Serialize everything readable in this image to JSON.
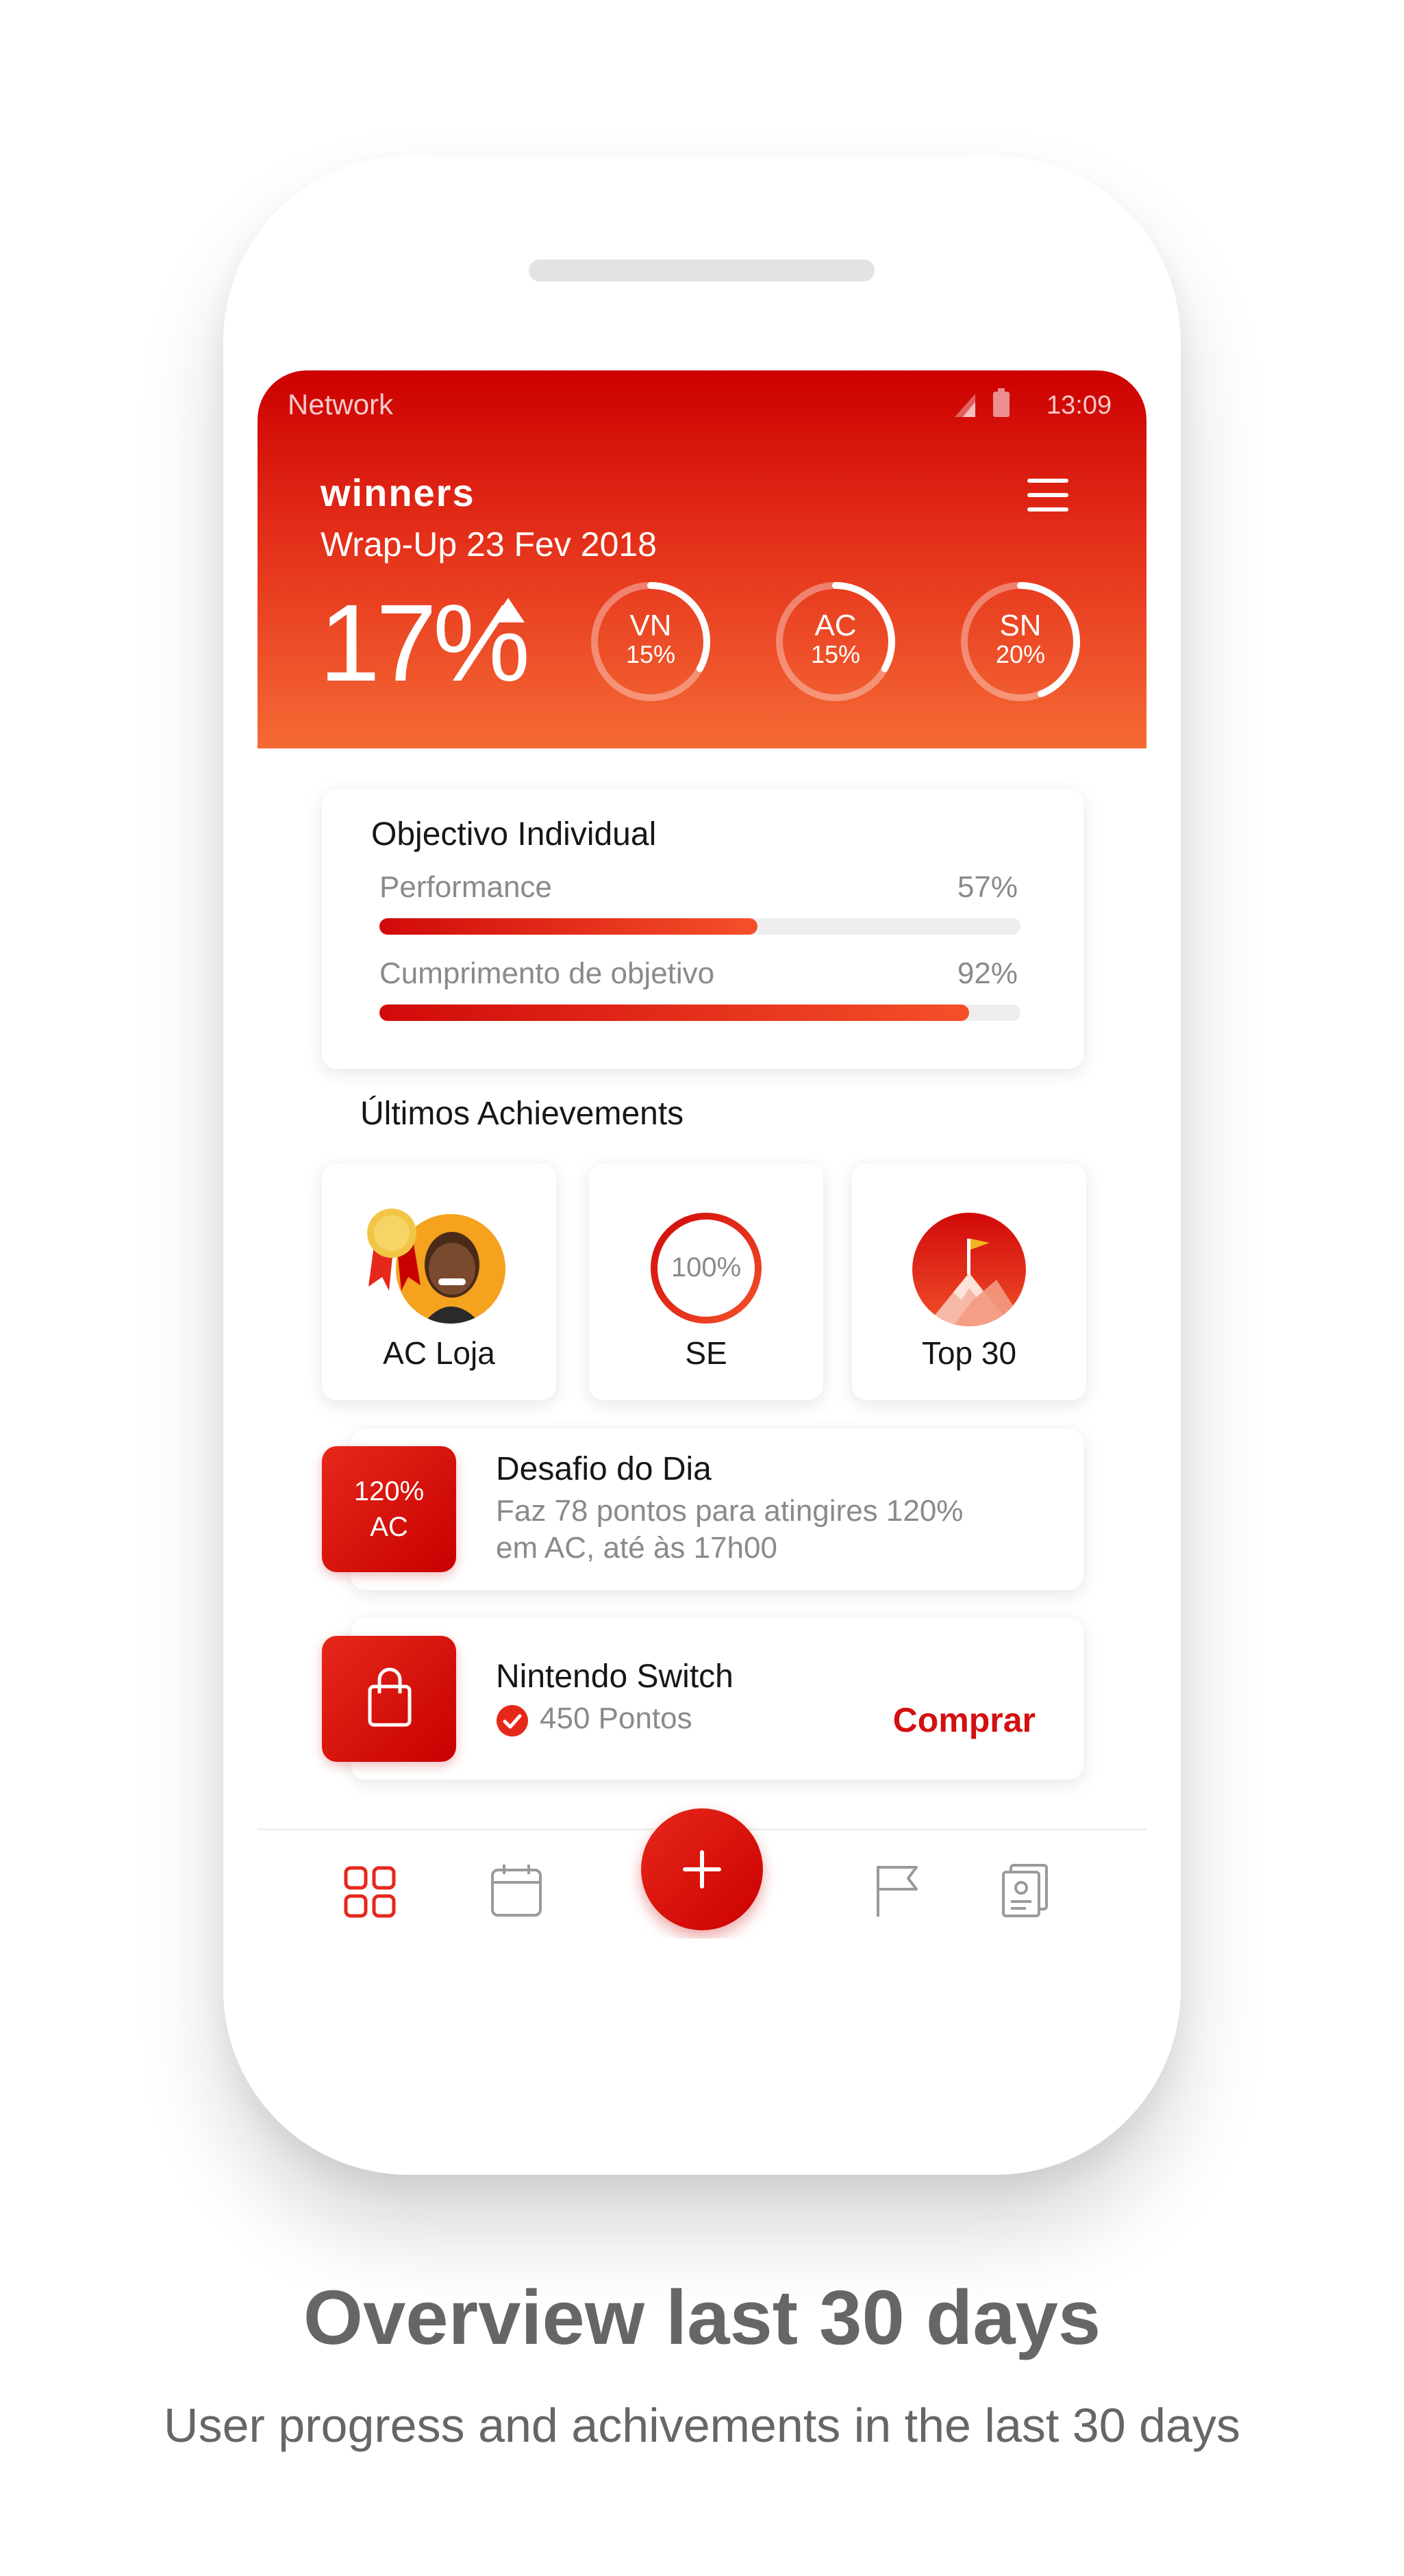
{
  "status_bar": {
    "network": "Network",
    "time": "13:09"
  },
  "header": {
    "brand": "winners",
    "subtitle": "Wrap-Up 23 Fev 2018",
    "main_percent": "17%",
    "trend": "up",
    "rings": [
      {
        "label": "VN",
        "value": "15%",
        "progress": 0.15
      },
      {
        "label": "AC",
        "value": "15%",
        "progress": 0.15
      },
      {
        "label": "SN",
        "value": "20%",
        "progress": 0.2
      }
    ]
  },
  "objective": {
    "title": "Objectivo Individual",
    "items": [
      {
        "label": "Performance",
        "value": "57%",
        "progress": 0.59
      },
      {
        "label": "Cumprimento de objetivo",
        "value": "92%",
        "progress": 0.92
      }
    ]
  },
  "achievements": {
    "title": "Últimos Achievements",
    "items": [
      {
        "label": "AC Loja",
        "icon": "medal-avatar-icon"
      },
      {
        "label": "SE",
        "badge": "100%",
        "icon": "progress-ring-icon"
      },
      {
        "label": "Top 30",
        "icon": "mountain-flag-icon"
      }
    ]
  },
  "challenge": {
    "tile_line1": "120%",
    "tile_line2": "AC",
    "title": "Desafio do Dia",
    "line1": "Faz 78 pontos para atingires 120%",
    "line2": "em AC, até às 17h00"
  },
  "reward": {
    "title": "Nintendo Switch",
    "points": "450 Pontos",
    "action": "Comprar",
    "icon": "shopping-bag-icon"
  },
  "nav": {
    "items": [
      "grid-icon",
      "calendar-icon",
      "plus-icon",
      "flag-icon",
      "id-card-icon"
    ],
    "active": "grid-icon"
  },
  "caption": {
    "title": "Overview last 30 days",
    "subtitle": "User progress and achivements in the last 30 days"
  },
  "colors": {
    "accent": "#d40f0f",
    "accent_light": "#f56a35",
    "text_gray": "#8a8a8a"
  }
}
